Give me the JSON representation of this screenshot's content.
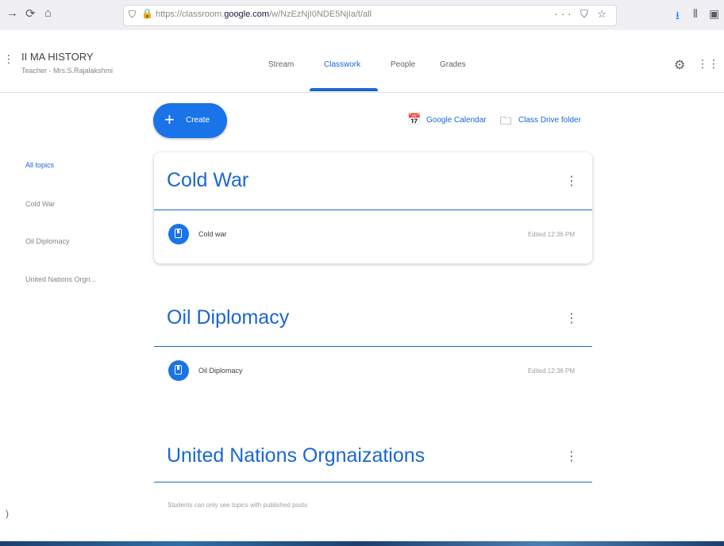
{
  "browser": {
    "back_icon": "arrow-left-icon",
    "url_host_prefix": "https://classroom.",
    "url_host_bold": "google.com",
    "url_path": "/w/NzEzNjI0NDE5NjIa/t/all",
    "page_actions": "··· ⛉ ☆"
  },
  "header": {
    "class_title": "II MA HISTORY",
    "class_subtitle": "Teacher - Mrs.S.Rajalakshmi",
    "tabs": [
      {
        "label": "Stream"
      },
      {
        "label": "Classwork"
      },
      {
        "label": "People"
      },
      {
        "label": "Grades"
      }
    ],
    "active_tab": "Classwork"
  },
  "sidebar": {
    "items": [
      {
        "label": "All topics"
      },
      {
        "label": "Cold War"
      },
      {
        "label": "Oil Diplomacy"
      },
      {
        "label": "United Nations Orgn..."
      }
    ]
  },
  "toolbar": {
    "create_label": "Create",
    "calendar_label": "Google Calendar",
    "drive_label": "Class Drive folder"
  },
  "topics": [
    {
      "title": "Cold War",
      "items": [
        {
          "title": "Cold war",
          "meta": "Edited 12:36 PM"
        }
      ]
    },
    {
      "title": "Oil Diplomacy",
      "items": [
        {
          "title": "Oil Diplomacy",
          "meta": "Edited 12:36 PM"
        }
      ]
    },
    {
      "title": "United Nations Orgnaizations",
      "items": []
    }
  ],
  "footer_note": "Students can only see topics with published posts",
  "colors": {
    "accent": "#1967d2",
    "create_button": "#1a73e8"
  }
}
